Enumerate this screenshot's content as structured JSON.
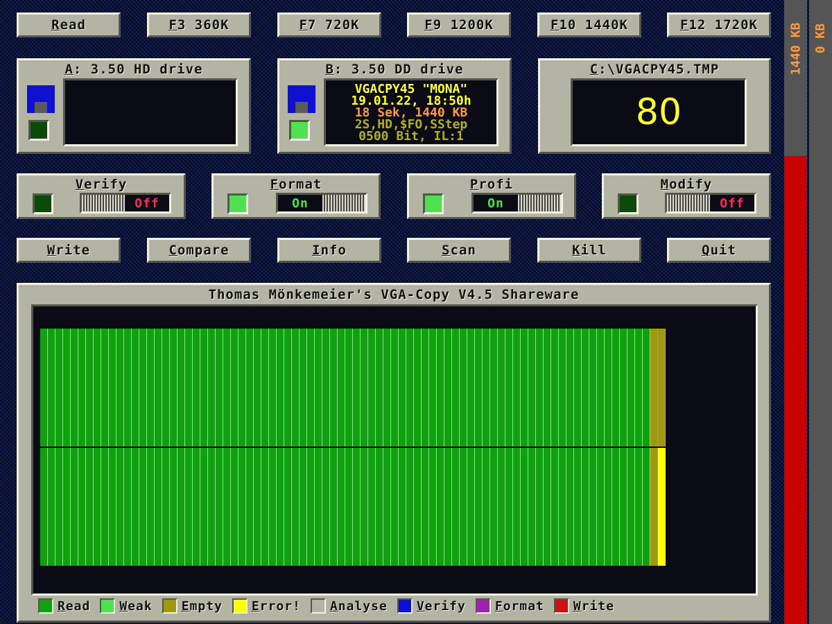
{
  "top_buttons": [
    {
      "key": "R",
      "rest": "ead"
    },
    {
      "key": "F",
      "rest": "3 360K"
    },
    {
      "key": "F",
      "rest": "7 720K"
    },
    {
      "key": "F",
      "rest": "9 1200K"
    },
    {
      "key": "F",
      "rest": "10 1440K"
    },
    {
      "key": "F",
      "rest": "12 1720K"
    }
  ],
  "drive_a": {
    "key": "A",
    "rest": ": 3.50 HD drive"
  },
  "drive_b": {
    "key": "B",
    "rest": ": 3.50 DD drive",
    "info_lines": [
      {
        "text": "VGACPY45 \"MONA\"",
        "color": "#ffff30"
      },
      {
        "text": "19.01.22, 18:50h",
        "color": "#ffff30"
      },
      {
        "text": "18 Sek, 1440 KB",
        "color": "#ff9a40"
      },
      {
        "text": "2S,HD,$FO,SStep",
        "color": "#b0b020"
      },
      {
        "text": "0500 Bit, IL:1",
        "color": "#b0b020"
      }
    ]
  },
  "drive_c": {
    "key": "C",
    "rest": ":\\VGACPY45.TMP",
    "value": "80"
  },
  "options": [
    {
      "key": "V",
      "rest": "erify",
      "state": "Off",
      "led": "dark"
    },
    {
      "key": "F",
      "rest": "ormat",
      "state": "On",
      "led": "light"
    },
    {
      "key": "P",
      "rest": "rofi",
      "state": "On",
      "led": "light"
    },
    {
      "key": "M",
      "rest": "odify",
      "state": "Off",
      "led": "dark"
    }
  ],
  "action_buttons": [
    {
      "key": "W",
      "rest": "rite"
    },
    {
      "key": "C",
      "rest": "ompare"
    },
    {
      "key": "I",
      "rest": "nfo"
    },
    {
      "key": "S",
      "rest": "can"
    },
    {
      "key": "K",
      "rest": "ill"
    },
    {
      "key": "Q",
      "rest": "uit"
    }
  ],
  "main_title": "Thomas Mönkemeier's VGA-Copy V4.5 Shareware",
  "track_map": {
    "tracks_per_side": 82,
    "side0": {
      "read": 80,
      "empty_tail": 2
    },
    "side1": {
      "read": 80,
      "empty": 1,
      "error": 1
    }
  },
  "legend": [
    {
      "key": "R",
      "rest": "ead",
      "color": "#12a012"
    },
    {
      "key": "W",
      "rest": "eak",
      "color": "#50e050"
    },
    {
      "key": "E",
      "rest": "mpty",
      "color": "#a09810"
    },
    {
      "key": "E",
      "rest": "rror!",
      "color": "#ffff00"
    },
    {
      "key": "A",
      "rest": "nalyse",
      "color": "#b4b4a4"
    },
    {
      "key": "V",
      "rest": "erify",
      "color": "#1010d0"
    },
    {
      "key": "F",
      "rest": "ormat",
      "color": "#a020b0"
    },
    {
      "key": "W",
      "rest": "rite",
      "color": "#d01010"
    }
  ],
  "sidebar": {
    "left_label": "1440 KB",
    "right_label": "0 KB",
    "fill_fraction": 0.75
  }
}
